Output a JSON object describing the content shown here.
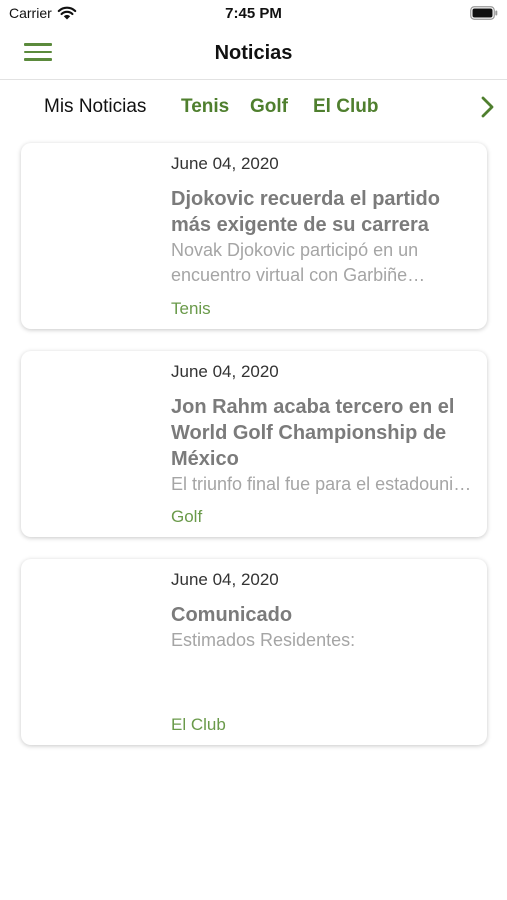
{
  "status_bar": {
    "carrier": "Carrier",
    "time": "7:45 PM",
    "icons": [
      "wifi-icon",
      "battery-icon"
    ]
  },
  "nav": {
    "title": "Noticias",
    "menu_icon": "hamburger-menu-icon"
  },
  "tabs": [
    {
      "label": "Mis Noticias",
      "active": true
    },
    {
      "label": "Tenis",
      "active": false
    },
    {
      "label": "Golf",
      "active": false
    },
    {
      "label": "El Club",
      "active": false
    }
  ],
  "tabs_more_icon": "chevron-right-icon",
  "news": [
    {
      "date": "June 04, 2020",
      "title": "Djokovic recuerda el partido más exigente de su carrera",
      "summary": "Novak Djokovic participó en un encuentro virtual con Garbiñe Muguruza",
      "category": "Tenis"
    },
    {
      "date": "June 04, 2020",
      "title": "Jon Rahm acaba tercero en el World Golf Championship de México",
      "summary": "El triunfo final fue para el estadounidense",
      "category": "Golf"
    },
    {
      "date": "June 04, 2020",
      "title": "Comunicado",
      "summary": "Estimados Residentes:",
      "category": "El Club"
    }
  ],
  "colors": {
    "accent": "#4f7f2e",
    "category": "#6a9a4a",
    "title_gray": "#7b7b7b",
    "summary_gray": "#a5a5a5"
  }
}
